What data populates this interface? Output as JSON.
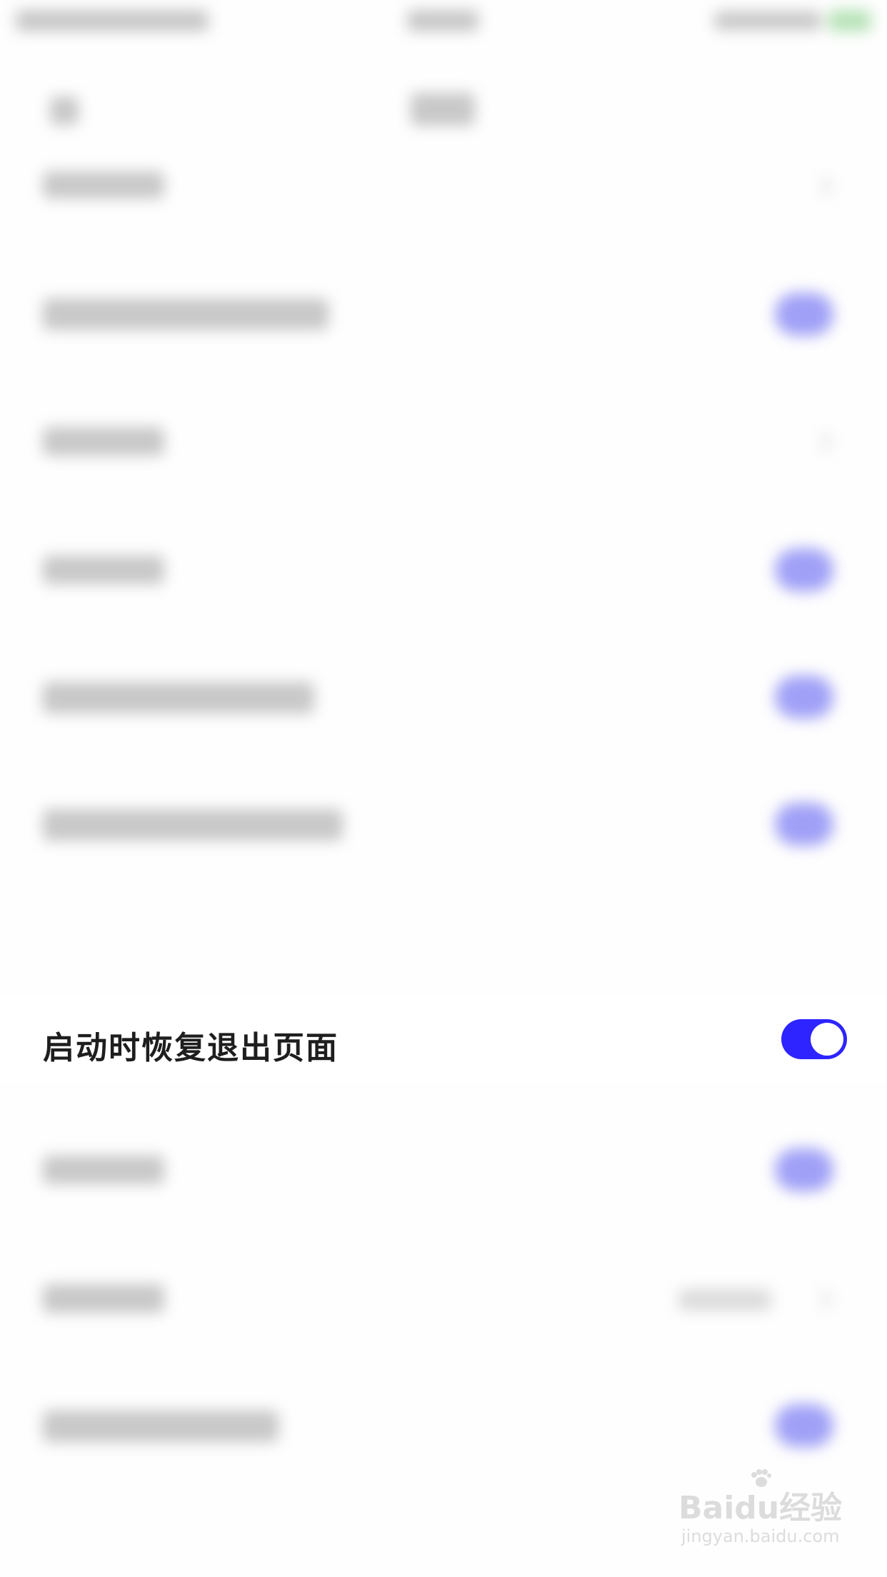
{
  "settings": {
    "focused_row": {
      "label": "启动时恢复退出页面",
      "toggle_on": true,
      "toggle_color": "#2d24ff"
    }
  },
  "watermark": {
    "brand": "Baidu经验",
    "url": "jingyan.baidu.com"
  },
  "colors": {
    "accent": "#2d24ff",
    "blurred_toggle": "#8f8ff6",
    "background": "#ffffff"
  }
}
